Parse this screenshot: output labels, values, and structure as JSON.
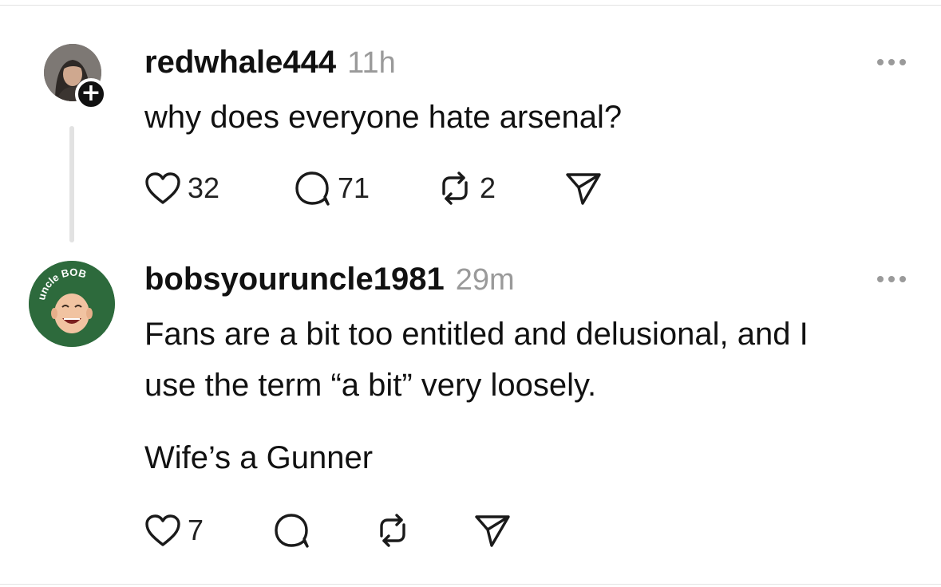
{
  "posts": [
    {
      "username": "redwhale444",
      "time": "11h",
      "lines": [
        "why does everyone hate arsenal?"
      ],
      "likes": "32",
      "replies": "71",
      "reposts": "2",
      "avatar_badge": "+"
    },
    {
      "username": "bobsyouruncle1981",
      "time": "29m",
      "lines": [
        "Fans are a bit too entitled and delusional, and I",
        "use the term “a bit” very loosely.",
        "Wife’s a Gunner"
      ],
      "likes": "7",
      "avatar_text": "uncle BOB"
    }
  ],
  "icons": {
    "like": "heart-icon",
    "reply": "comment-icon",
    "repost": "repost-icon",
    "share": "send-icon",
    "more": "more-icon"
  },
  "colors": {
    "text": "#111111",
    "muted": "#9a9a9a",
    "avatar2_bg": "#2d6a3c"
  }
}
